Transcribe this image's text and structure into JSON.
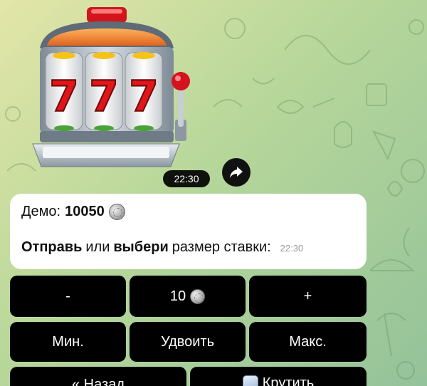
{
  "message": {
    "time": "22:30",
    "demo_label": "Демо:",
    "balance": "10050",
    "send_word": "Отправь",
    "or_word": "или",
    "choose_word": "выбери",
    "rest": "размер ставки:",
    "bubble_time": "22:30"
  },
  "sticker": {
    "reels": [
      "7",
      "7",
      "7"
    ]
  },
  "keyboard": {
    "minus": "-",
    "stake": "10",
    "plus": "+",
    "min": "Мин.",
    "double": "Удвоить",
    "max": "Макс.",
    "back": "« Назад",
    "spin": "Крутить"
  },
  "colors": {
    "button_bg": "#000000",
    "bubble_bg": "#ffffff",
    "reel_digit": "#e0161b"
  }
}
